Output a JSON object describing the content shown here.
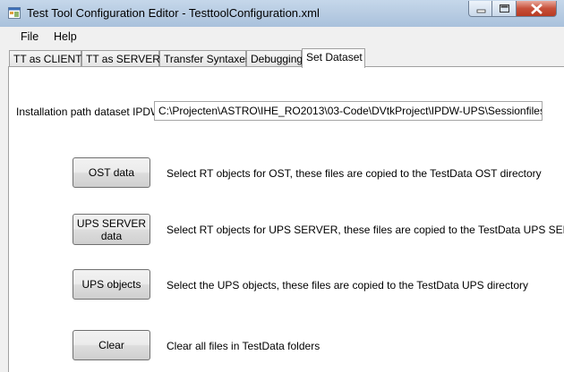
{
  "window": {
    "title": "Test Tool Configuration Editor - TesttoolConfiguration.xml"
  },
  "menu": {
    "items": [
      "File",
      "Help"
    ]
  },
  "tabs": [
    "TT as CLIENT",
    "TT as SERVER",
    "Transfer Syntaxes",
    "Debugging",
    "Set Dataset"
  ],
  "active_tab": "Set Dataset",
  "dataset": {
    "path_label": "Installation path dataset IPDW:",
    "path_value": "C:\\Projecten\\ASTRO\\IHE_RO2013\\03-Code\\DVtkProject\\IPDW-UPS\\Sessionfiles\\Scripts"
  },
  "actions": [
    {
      "label": "OST data",
      "description": "Select RT objects for OST, these files are copied to the TestData OST directory"
    },
    {
      "label": "UPS SERVER data",
      "description": "Select RT objects for UPS SERVER, these files are copied to the TestData UPS SERVER directory"
    },
    {
      "label": "UPS objects",
      "description": "Select the UPS objects, these files are copied to the TestData UPS directory"
    },
    {
      "label": "Clear",
      "description": "Clear all files in TestData folders"
    }
  ],
  "colors": {
    "titlebar": "#b9cde3",
    "close_button": "#c7503a",
    "panel": "#ffffff",
    "window_bg": "#f0f0f0"
  }
}
